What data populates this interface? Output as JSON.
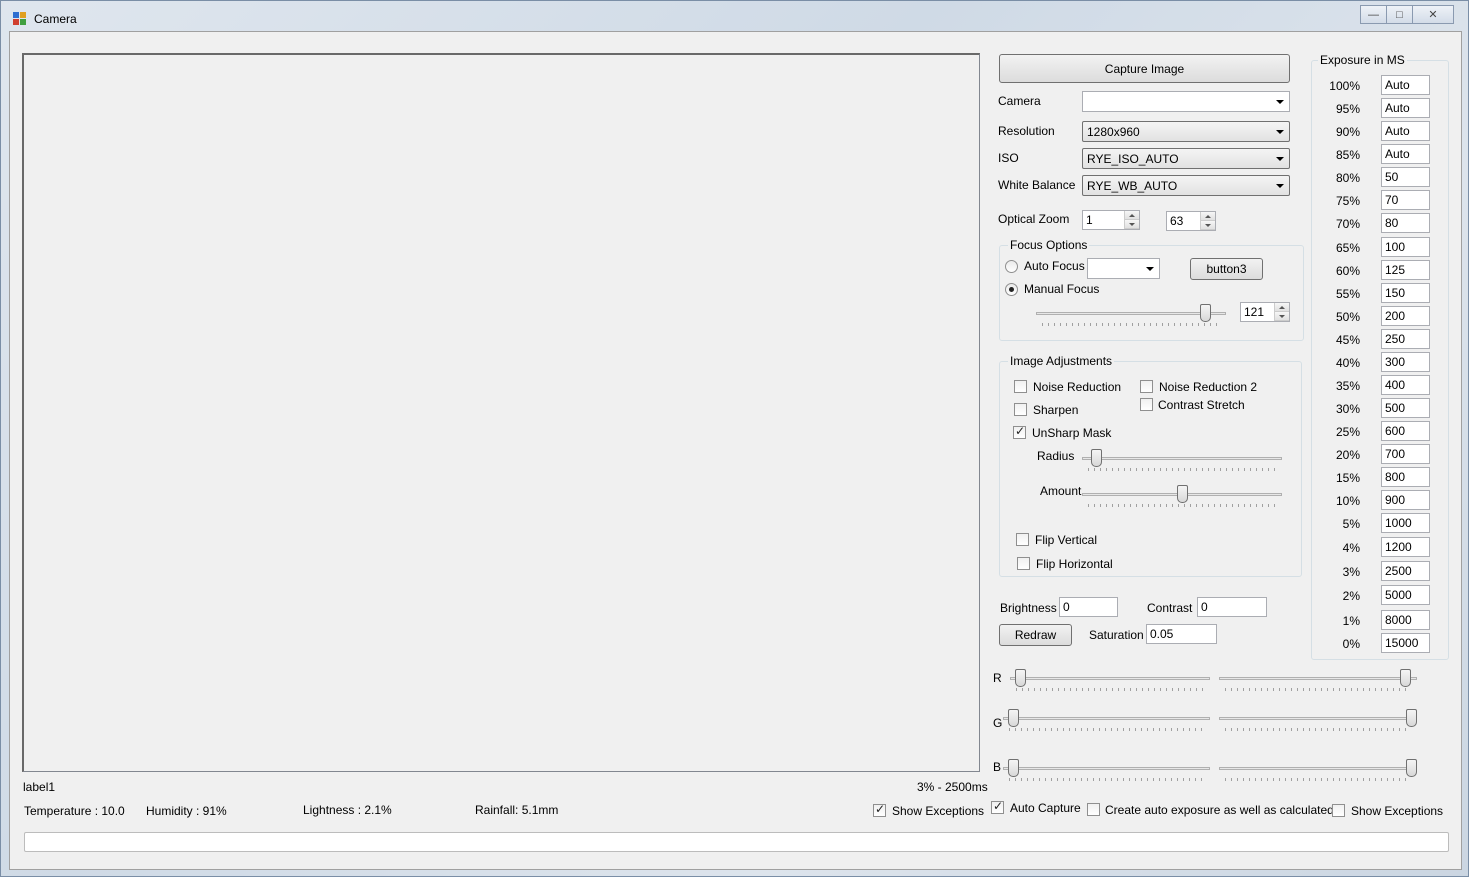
{
  "window": {
    "title": "Camera"
  },
  "capture_button": "Capture Image",
  "camera": {
    "label": "Camera",
    "value": ""
  },
  "resolution": {
    "label": "Resolution",
    "value": "1280x960"
  },
  "iso": {
    "label": "ISO",
    "value": "RYE_ISO_AUTO"
  },
  "white_balance": {
    "label": "White Balance",
    "value": "RYE_WB_AUTO"
  },
  "optical_zoom": {
    "label": "Optical Zoom",
    "value1": "1",
    "value2": "63"
  },
  "focus": {
    "title": "Focus Options",
    "auto_label": "Auto Focus",
    "manual_label": "Manual Focus",
    "auto_value": "",
    "button3": "button3",
    "focus_value": "121",
    "manual_selected": true
  },
  "image_adjustments": {
    "title": "Image Adjustments",
    "noise_reduction": "Noise Reduction",
    "noise_reduction_2": "Noise Reduction 2",
    "sharpen": "Sharpen",
    "contrast_stretch": "Contrast Stretch",
    "unsharp_mask": "UnSharp Mask",
    "unsharp_checked": true,
    "radius": "Radius",
    "amount": "Amount",
    "flip_vertical": "Flip Vertical",
    "flip_horizontal": "Flip Horizontal"
  },
  "brightness": {
    "label": "Brightness",
    "value": "0"
  },
  "contrast": {
    "label": "Contrast",
    "value": "0"
  },
  "redraw_button": "Redraw",
  "saturation": {
    "label": "Saturation",
    "value": "0.05"
  },
  "rgb": {
    "r": "R",
    "g": "G",
    "b": "B"
  },
  "exposure": {
    "title": "Exposure in MS",
    "rows": [
      {
        "pct": "100%",
        "value": "Auto"
      },
      {
        "pct": "95%",
        "value": "Auto"
      },
      {
        "pct": "90%",
        "value": "Auto"
      },
      {
        "pct": "85%",
        "value": "Auto"
      },
      {
        "pct": "80%",
        "value": "50"
      },
      {
        "pct": "75%",
        "value": "70"
      },
      {
        "pct": "70%",
        "value": "80"
      },
      {
        "pct": "65%",
        "value": "100"
      },
      {
        "pct": "60%",
        "value": "125"
      },
      {
        "pct": "55%",
        "value": "150"
      },
      {
        "pct": "50%",
        "value": "200"
      },
      {
        "pct": "45%",
        "value": "250"
      },
      {
        "pct": "40%",
        "value": "300"
      },
      {
        "pct": "35%",
        "value": "400"
      },
      {
        "pct": "30%",
        "value": "500"
      },
      {
        "pct": "25%",
        "value": "600"
      },
      {
        "pct": "20%",
        "value": "700"
      },
      {
        "pct": "15%",
        "value": "800"
      },
      {
        "pct": "10%",
        "value": "900"
      },
      {
        "pct": "5%",
        "value": "1000"
      },
      {
        "pct": "4%",
        "value": "1200"
      },
      {
        "pct": "3%",
        "value": "2500"
      },
      {
        "pct": "2%",
        "value": "5000"
      },
      {
        "pct": "1%",
        "value": "8000"
      },
      {
        "pct": "0%",
        "value": "15000"
      }
    ]
  },
  "status": {
    "label1": "label1",
    "exposure_info": "3% - 2500ms",
    "temperature": "Temperature : 10.0",
    "humidity": "Humidity : 91%",
    "lightness": "Lightness : 2.1%",
    "rainfall": "Rainfall: 5.1mm",
    "show_exceptions_1": "Show Exceptions",
    "auto_capture": "Auto Capture",
    "create_auto_exposure": "Create auto exposure as well as calculated?",
    "show_exceptions_2": "Show Exceptions"
  }
}
